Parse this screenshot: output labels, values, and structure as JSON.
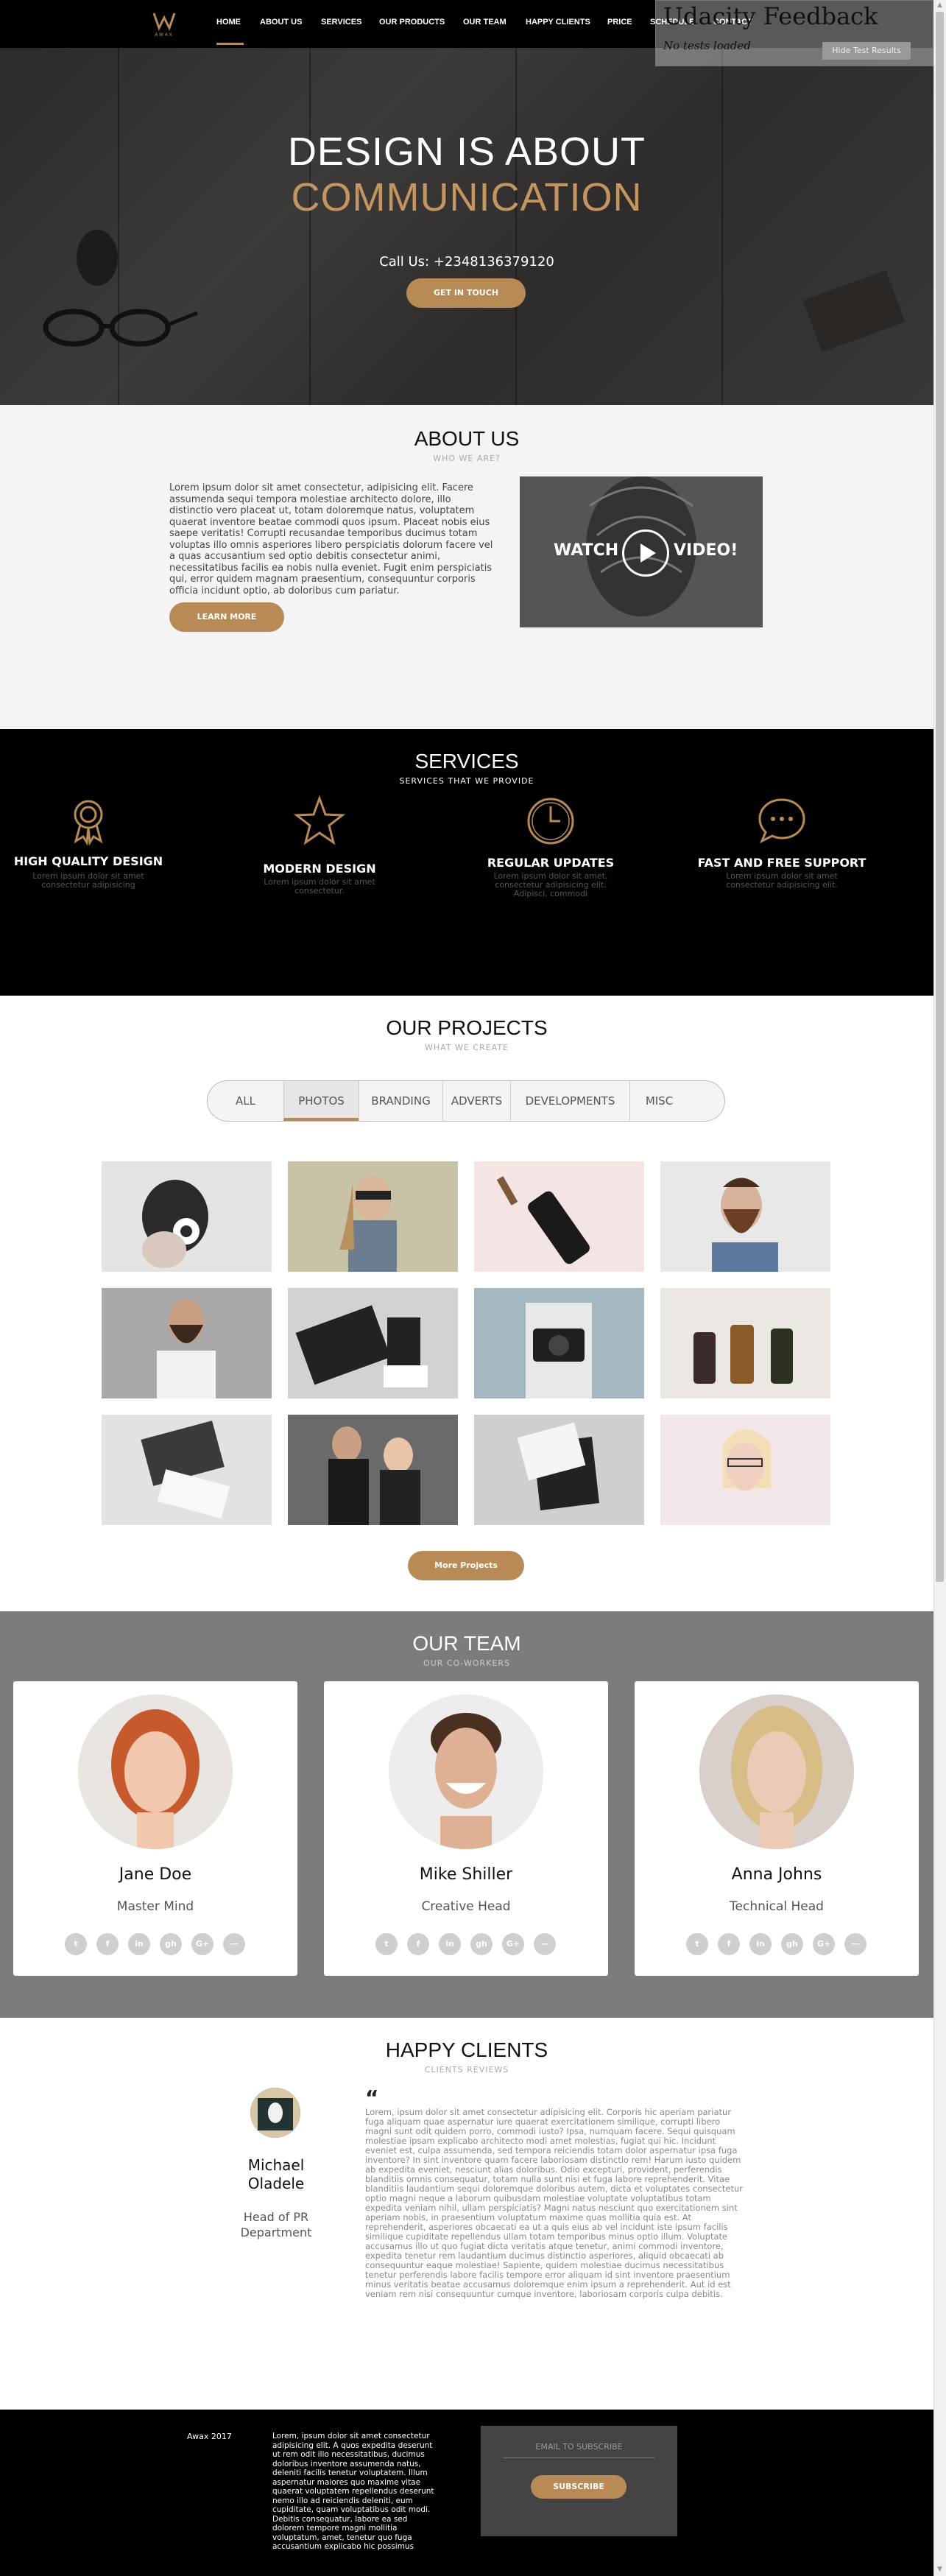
{
  "nav": {
    "logo_text": "AWAX",
    "items": [
      "HOME",
      "ABOUT US",
      "SERVICES",
      "OUR PRODUCTS",
      "OUR TEAM",
      "HAPPY CLIENTS",
      "PRICE",
      "SCHEDULE",
      "CONTACT"
    ]
  },
  "udacity": {
    "title": "Udacity Feedback",
    "status": "No tests loaded",
    "button": "Hide Test Results"
  },
  "hero": {
    "line1": "DESIGN IS ABOUT",
    "line2": "COMMUNICATION",
    "call": "Call Us: +2348136379120",
    "button": "GET IN TOUCH"
  },
  "about": {
    "title": "ABOUT US",
    "subtitle": "WHO WE ARE?",
    "text": "Lorem ipsum dolor sit amet consectetur, adipisicing elit. Facere assumenda sequi tempora molestiae architecto dolore, illo distinctio vero placeat ut, totam doloremque natus, voluptatem quaerat inventore beatae commodi quos ipsum. Placeat nobis eius saepe veritatis! Corrupti recusandae temporibus ducimus totam voluptas illo omnis asperiores libero perspiciatis dolorum facere vel a quas accusantium sed optio debitis consectetur animi, necessitatibus facilis ea nobis nulla eveniet. Fugit enim perspiciatis qui, error quidem magnam praesentium, consequuntur corporis officia incidunt optio, ab doloribus cum pariatur.",
    "button": "LEARN MORE",
    "video_left": "WATCH",
    "video_right": "VIDEO!"
  },
  "services": {
    "title": "SERVICES",
    "subtitle": "SERVICES THAT WE PROVIDE",
    "items": [
      {
        "title": "HIGH QUALITY DESIGN",
        "desc": "Lorem ipsum dolor sit amet consectetur adipisicing",
        "icon": "award-icon"
      },
      {
        "title": "MODERN DESIGN",
        "desc": "Lorem ipsum dolor sit amet consectetur.",
        "icon": "star-icon"
      },
      {
        "title": "REGULAR UPDATES",
        "desc": "Lorem ipsum dolor sit amet, consectetur adipisicing elit. Adipisci, commodi",
        "icon": "clock-icon"
      },
      {
        "title": "FAST AND FREE SUPPORT",
        "desc": "Lorem ipsum dolor sit amet consectetur adipisicing elit.",
        "icon": "chat-icon"
      }
    ]
  },
  "projects": {
    "title": "OUR PROJECTS",
    "subtitle": "WHAT WE CREATE",
    "tabs": [
      "ALL",
      "PHOTOS",
      "BRANDING",
      "ADVERTS",
      "DEVELOPMENTS",
      "MISC"
    ],
    "active_tab": "PHOTOS",
    "button": "More Projects"
  },
  "team": {
    "title": "OUR TEAM",
    "subtitle": "OUR CO-WORKERS",
    "members": [
      {
        "name": "Jane Doe",
        "role": "Master Mind"
      },
      {
        "name": "Mike Shiller",
        "role": "Creative Head"
      },
      {
        "name": "Anna Johns",
        "role": "Technical Head"
      }
    ],
    "social": [
      "t",
      "f",
      "in",
      "gh",
      "G+",
      "—"
    ]
  },
  "clients": {
    "title": "HAPPY CLIENTS",
    "subtitle": "CLIENTS REVIEWS",
    "name": "Michael Oladele",
    "role": "Head of PR Department",
    "quote_mark": "“",
    "text": "Lorem, ipsum dolor sit amet consectetur adipisicing elit. Corporis hic aperiam pariatur fuga aliquam quae aspernatur iure quaerat exercitationem similique, corrupti libero magni sunt odit quidem porro, commodi iusto? Ipsa, numquam facere. Sequi quisquam molestiae ipsam explicabo architecto modi amet molestias, fugiat qui hic. Incidunt eveniet est, culpa assumenda, sed tempora reiciendis totam dolor aspernatur ipsa fuga inventore? In sint inventore quam facere laboriosam distinctio rem! Harum iusto quidem ab expedita eveniet, nesciunt alias doloribus. Odio excepturi, provident, perferendis blanditiis omnis consequatur, totam nulla sunt nisi et fuga labore reprehenderit. Vitae blanditiis laudantium sequi doloremque doloribus autem, dicta et voluptates consectetur optio magni neque a laborum quibusdam molestiae voluptate voluptatibus totam expedita veniam nihil, ullam perspiciatis? Magni natus nesciunt quo exercitationem sint aperiam nobis, in praesentium voluptatum maxime quas mollitia quia est. At reprehenderit, asperiores obcaecati ea ut a quis eius ab vel incidunt iste ipsum facilis similique cupiditate repellendus ullam totam temporibus minus optio illum. Voluptate accusamus illo ut quo fugiat dicta veritatis atque tenetur, animi commodi inventore, expedita tenetur rem laudantium ducimus distinctio asperiores, aliquid obcaecati ab consequuntur eaque molestiae! Sapiente, quidem molestiae ducimus necessitatibus tenetur perferendis labore facilis tempore error aliquam id sint inventore praesentium minus veritatis beatae accusamus doloremque enim ipsum a reprehenderit. Aut id est veniam rem nisi consequuntur cumque inventore, laboriosam corporis culpa debitis."
  },
  "footer": {
    "year": "Awax 2017",
    "text": "Lorem, ipsum dolor sit amet consectetur adipisicing elit. A quos expedita deserunt ut rem odit illo necessitatibus, ducimus doloribus inventore assumenda natus, deleniti facilis tenetur voluptatem. Illum aspernatur maiores quo maxime vitae quaerat voluptatem repellendus deserunt nemo illo ad reiciendis deleniti, eum cupiditate, quam voluptatibus odit modi. Debitis consequatur, labore ea sed dolorem tempore magni mollitia voluptatum, amet, tenetur quo fuga accusantium explicabo hic possimus",
    "email_placeholder": "EMAIL TO SUBSCRIBE",
    "button": "SUBSCRIBE"
  },
  "colors": {
    "accent": "#b88a55",
    "dark": "#000000",
    "light": "#f4f4f4"
  }
}
